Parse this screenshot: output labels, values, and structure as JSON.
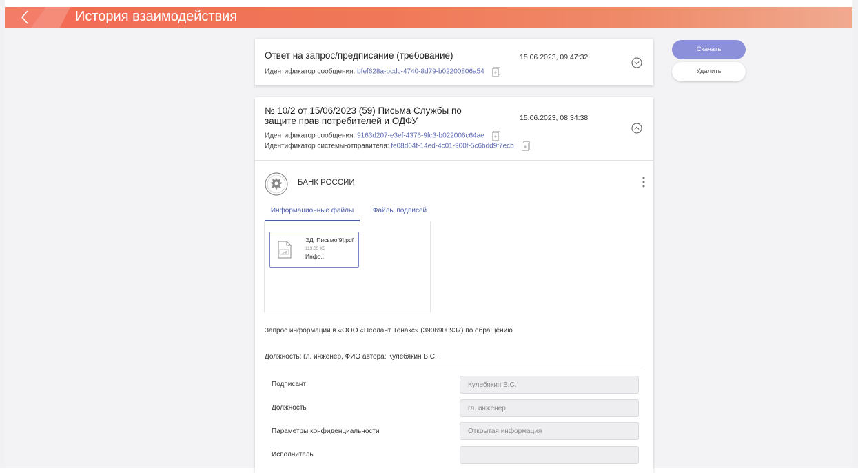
{
  "header": {
    "title": "История взаимодействия"
  },
  "messages": [
    {
      "title": "Ответ на запрос/предписание (требование)",
      "date": "15.06.2023, 09:47:32",
      "message_id_label": "Идентификатор сообщения:",
      "message_id": "bfef628a-bcdc-4740-8d79-b02200806a54"
    },
    {
      "title_line1": "№ 10/2 от 15/06/2023 (59) Письма Службы по",
      "title_line2": "защите прав потребителей и ОДФУ",
      "date": "15.06.2023, 08:34:38",
      "message_id_label": "Идентификатор сообщения:",
      "message_id": "9163d207-e3ef-4376-9fc3-b022006c64ae",
      "sender_id_label": "Идентификатор системы-отправителя:",
      "sender_id": "fe08d64f-14ed-4c01-900f-5c6bdd9f7ecb",
      "sender": "БАНК РОССИИ",
      "tabs": [
        "Информационные файлы",
        "Файлы подписей"
      ],
      "file": {
        "name": "ЭД_Письмо[9].pdf",
        "size": "113.05 КБ",
        "type": "Инфо...",
        "badge": ".pdf"
      },
      "description": "Запрос информации в «ООО «Неолант Тенакс» (3906900937) по обращению",
      "author_line": "Должность: гл. инженер, ФИО автора: Кулебякин В.С.",
      "form": [
        {
          "label": "Подписант",
          "value": "Кулебякин В.С."
        },
        {
          "label": "Должность",
          "value": "гл. инженер"
        },
        {
          "label": "Параметры конфиденциальности",
          "value": "Открытая информация"
        },
        {
          "label": "Исполнитель",
          "value": ""
        }
      ]
    }
  ],
  "actions": {
    "download": "Скачать",
    "delete": "Удалить"
  },
  "colors": {
    "header_start": "#f26a55",
    "header_end": "#f0aa90",
    "link": "#5f6bb0",
    "accent_button": "#8c8fd9"
  },
  "icons": [
    "back-arrow-icon",
    "copy-icon",
    "chevron-down-icon",
    "chevron-up-icon",
    "bank-emblem-icon",
    "more-vertical-icon",
    "pdf-file-icon"
  ]
}
